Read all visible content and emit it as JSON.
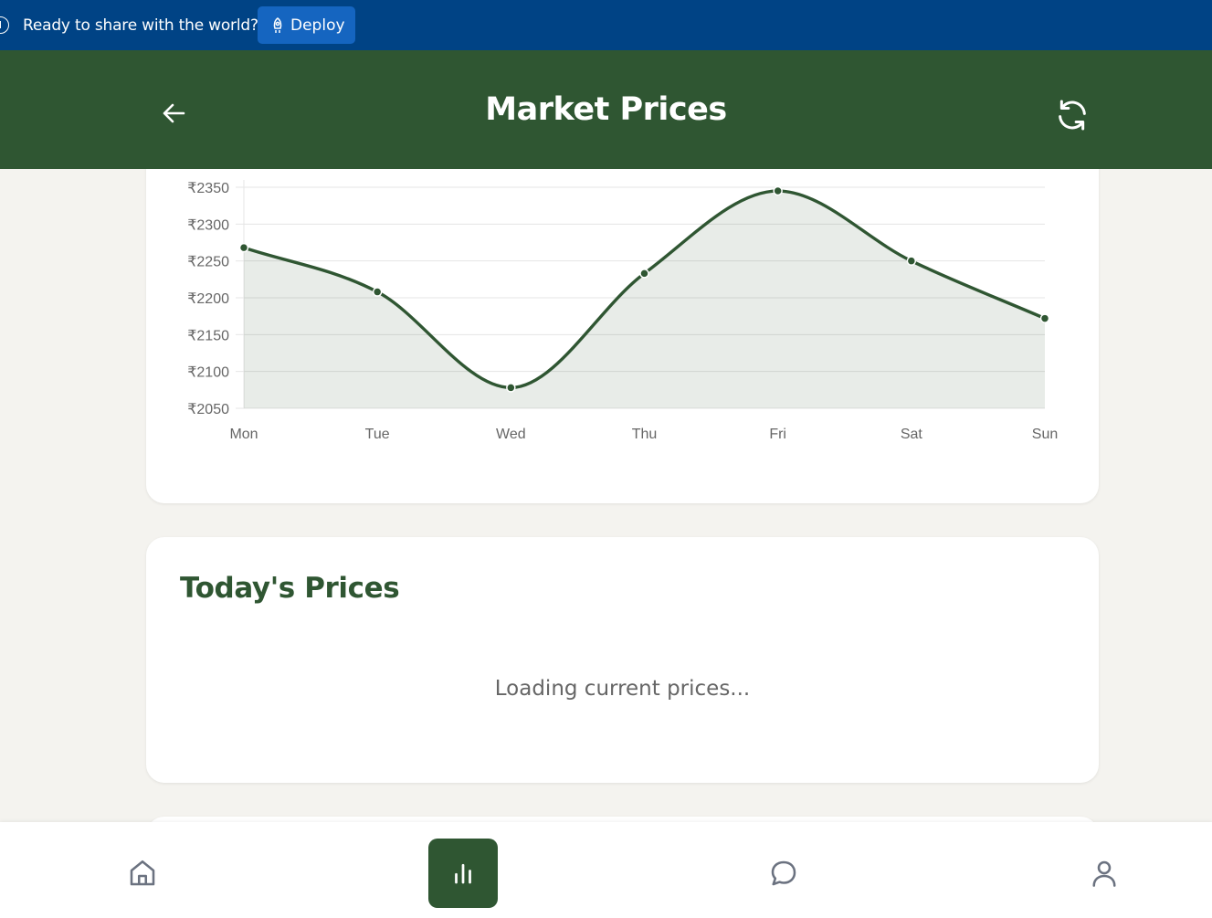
{
  "deploy_bar": {
    "message": "Ready to share with the world?",
    "button_label": "Deploy"
  },
  "header": {
    "title": "Market Prices"
  },
  "chart_data": {
    "type": "line",
    "categories": [
      "Mon",
      "Tue",
      "Wed",
      "Thu",
      "Fri",
      "Sat",
      "Sun"
    ],
    "series": [
      {
        "values": [
          2268,
          2208,
          2078,
          2233,
          2345,
          2250,
          2172
        ]
      }
    ],
    "yticks": [
      "₹2050",
      "₹2100",
      "₹2150",
      "₹2200",
      "₹2250",
      "₹2300",
      "₹2350"
    ],
    "ylim": [
      2050,
      2350
    ],
    "grid": true,
    "fill": true,
    "color": "#2f5632"
  },
  "todays_prices": {
    "title": "Today's Prices",
    "loading": "Loading current prices..."
  },
  "nav": {
    "items": [
      "home-icon",
      "bar-chart-icon",
      "chat-icon",
      "profile-icon"
    ],
    "active": "bar-chart-icon",
    "active_color": "#2f5632"
  }
}
